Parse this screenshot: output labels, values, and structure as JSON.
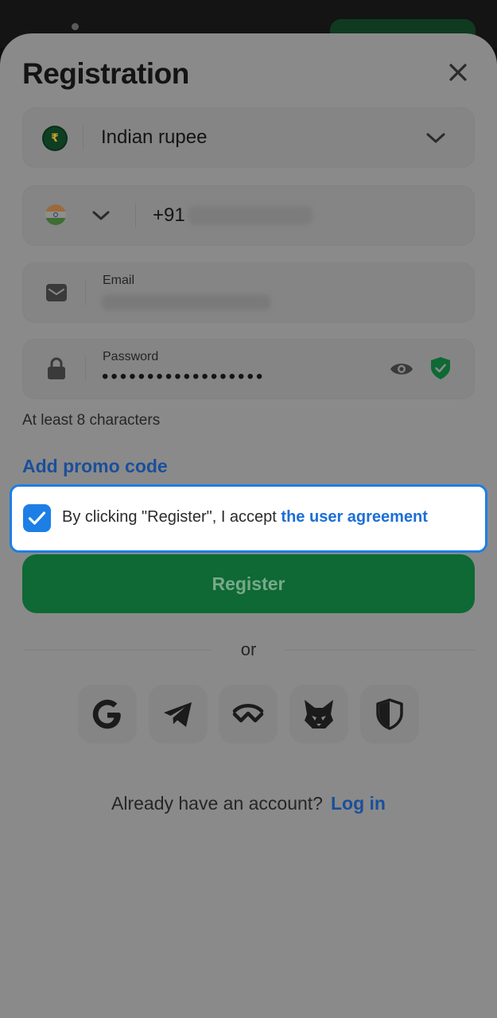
{
  "title": "Registration",
  "currency": {
    "symbol": "₹",
    "label": "Indian rupee"
  },
  "phone": {
    "code": "+91"
  },
  "email": {
    "label": "Email"
  },
  "password": {
    "label": "Password",
    "masked": "••••••••••••••••••"
  },
  "hint": "At least 8 characters",
  "promo_label": "Add promo code",
  "agreement": {
    "prefix": "By clicking \"Register\", I accept ",
    "link": "the user agreement",
    "checked": true
  },
  "register_label": "Register",
  "or_label": "or",
  "social": [
    {
      "icon": "google-icon"
    },
    {
      "icon": "telegram-icon"
    },
    {
      "icon": "walletconnect-icon"
    },
    {
      "icon": "metamask-icon"
    },
    {
      "icon": "shield-icon"
    }
  ],
  "login": {
    "prompt": "Already have an account?",
    "link": "Log in"
  },
  "colors": {
    "accent": "#1c7fe6",
    "register_green": "#0e6934",
    "link_blue": "#1a4f9a"
  }
}
